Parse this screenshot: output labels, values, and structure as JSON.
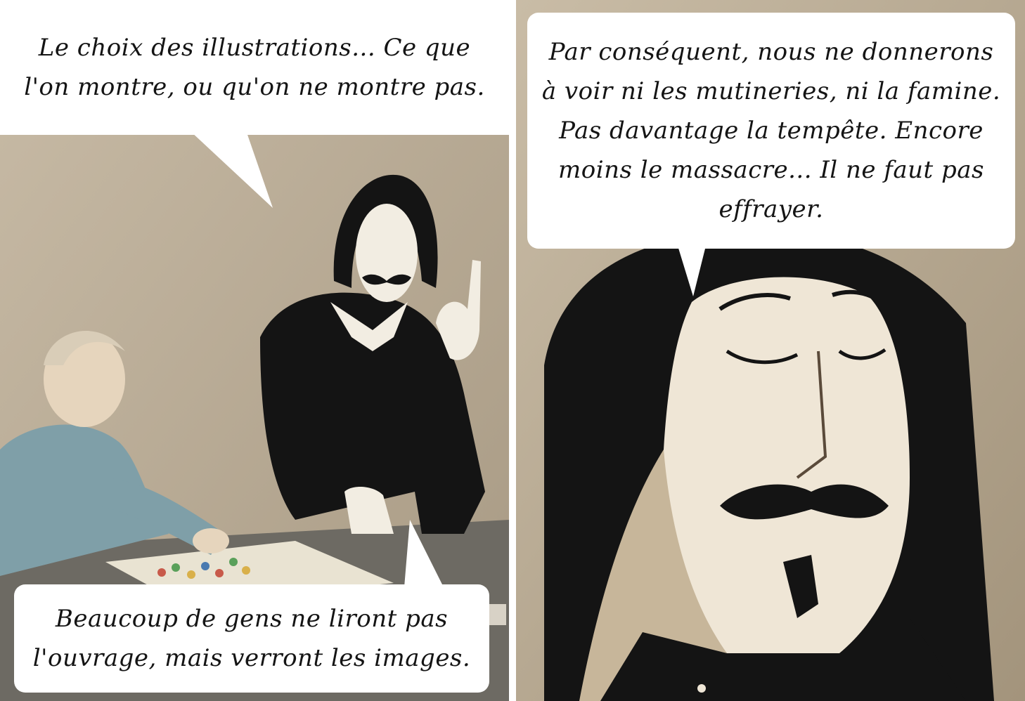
{
  "panels": {
    "left": {
      "top_bubble": {
        "text": "Le choix des illustrations... Ce que\nl'on montre, ou qu'on ne montre pas."
      },
      "bottom_bubble": {
        "text": "Beaucoup de gens ne liront pas\nl'ouvrage, mais verront les images."
      }
    },
    "right": {
      "top_bubble": {
        "text": "Par conséquent, nous ne donnerons\nà voir ni les mutineries, ni la famine.\nPas davantage la tempête. Encore\nmoins le massacre... Il ne faut pas\neffrayer."
      }
    }
  }
}
